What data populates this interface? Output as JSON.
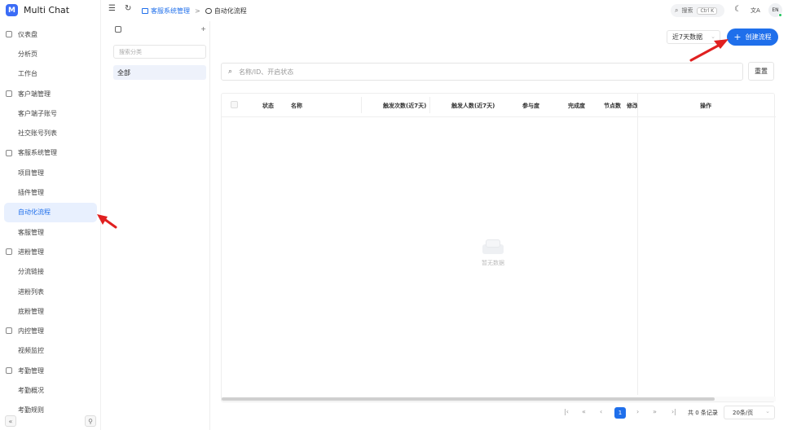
{
  "app": {
    "title": "Multi Chat",
    "logo_letter": "M"
  },
  "colors": {
    "accent": "#1f6feb",
    "arrow": "#e02020"
  },
  "sidebar": {
    "items": [
      {
        "label": "仪表盘",
        "group": true,
        "icon": "dashboard-icon"
      },
      {
        "label": "分析页",
        "group": false
      },
      {
        "label": "工作台",
        "group": false
      },
      {
        "label": "客户端管理",
        "group": true,
        "icon": "user-icon"
      },
      {
        "label": "客户端子账号",
        "group": false
      },
      {
        "label": "社交账号列表",
        "group": false
      },
      {
        "label": "客服系统管理",
        "group": true,
        "icon": "service-icon"
      },
      {
        "label": "项目管理",
        "group": false
      },
      {
        "label": "插件管理",
        "group": false
      },
      {
        "label": "自动化流程",
        "group": false,
        "active": true
      },
      {
        "label": "客服管理",
        "group": false
      },
      {
        "label": "进粉管理",
        "group": true,
        "icon": "user-add-icon"
      },
      {
        "label": "分流链接",
        "group": false
      },
      {
        "label": "进粉列表",
        "group": false
      },
      {
        "label": "底粉管理",
        "group": false
      },
      {
        "label": "内控管理",
        "group": true,
        "icon": "shield-icon"
      },
      {
        "label": "视频监控",
        "group": false
      },
      {
        "label": "考勤管理",
        "group": true,
        "icon": "calendar-icon"
      },
      {
        "label": "考勤概况",
        "group": false
      },
      {
        "label": "考勤规则",
        "group": false
      }
    ],
    "collapse_glyph": "«",
    "pin_glyph": "⚲"
  },
  "topbar": {
    "menu_glyph": "☰",
    "refresh_glyph": "↻",
    "crumb_parent": "客服系统管理",
    "crumb_sep": ">",
    "crumb_current": "自动化流程",
    "search_label": "搜索",
    "search_kbd": "Ctrl K",
    "theme_glyph": "☾",
    "translate_glyph": "文A",
    "lang": "EN"
  },
  "category": {
    "search_placeholder": "搜索分类",
    "add_glyph": "+",
    "all_label": "全部"
  },
  "toolbar": {
    "period_value": "近7天数据",
    "create_label": "创建流程",
    "create_glyph": "+",
    "filter_placeholder": "名称/ID、开启状态",
    "reset_label": "重置"
  },
  "table": {
    "columns": [
      "状态",
      "名称",
      "触发次数(近7天)",
      "触发人数(近7天)",
      "参与度",
      "完成度",
      "节点数",
      "修改",
      "操作"
    ],
    "empty_text": "暂无数据"
  },
  "pager": {
    "current_page": "1",
    "total_text": "共 0 条记录",
    "page_size": "20条/页"
  }
}
